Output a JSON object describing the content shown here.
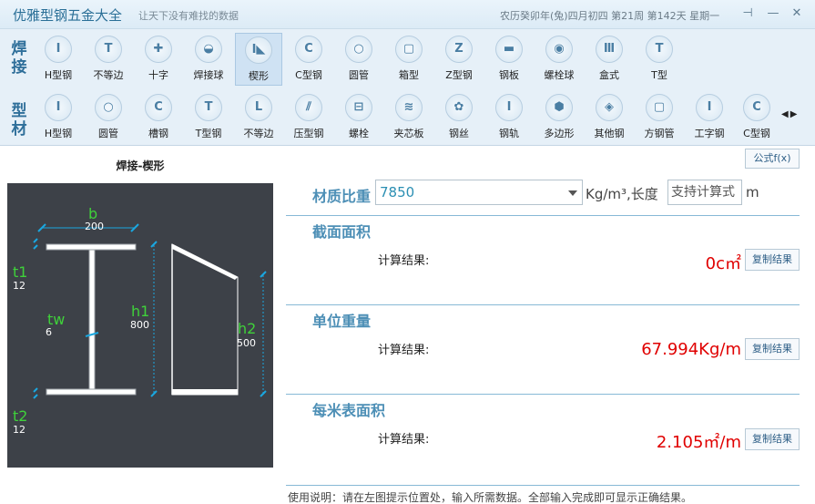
{
  "window": {
    "title": "优雅型钢五金大全",
    "subtitle": "让天下没有难找的数据",
    "date_text": "农历癸卯年(兔)四月初四 第21周 第142天 星期一",
    "buttons": {
      "pin": "⊣",
      "minimize": "—",
      "close": "✕"
    }
  },
  "toolbar": {
    "weld_group_label": "焊接",
    "profile_group_label": "型材",
    "weld_items": [
      {
        "label": "H型钢",
        "icon": "I"
      },
      {
        "label": "不等边",
        "icon": "T"
      },
      {
        "label": "十字",
        "icon": "✚"
      },
      {
        "label": "焊接球",
        "icon": "◒"
      },
      {
        "label": "楔形",
        "icon": "I◣"
      },
      {
        "label": "C型钢",
        "icon": "C"
      },
      {
        "label": "圆管",
        "icon": "○"
      },
      {
        "label": "箱型",
        "icon": "▢"
      },
      {
        "label": "Z型钢",
        "icon": "Z"
      },
      {
        "label": "钢板",
        "icon": "▬"
      },
      {
        "label": "螺栓球",
        "icon": "◉"
      },
      {
        "label": "盒式",
        "icon": "Ⅲ"
      },
      {
        "label": "T型",
        "icon": "T"
      }
    ],
    "profile_items": [
      {
        "label": "H型钢",
        "icon": "I"
      },
      {
        "label": "圆管",
        "icon": "○"
      },
      {
        "label": "槽钢",
        "icon": "C"
      },
      {
        "label": "T型钢",
        "icon": "T"
      },
      {
        "label": "不等边",
        "icon": "L"
      },
      {
        "label": "压型钢",
        "icon": "⫽"
      },
      {
        "label": "螺栓",
        "icon": "⊟"
      },
      {
        "label": "夹芯板",
        "icon": "≋"
      },
      {
        "label": "钢丝",
        "icon": "✿"
      },
      {
        "label": "钢轨",
        "icon": "I"
      },
      {
        "label": "多边形",
        "icon": "⬢"
      },
      {
        "label": "其他钢",
        "icon": "◈"
      },
      {
        "label": "方钢管",
        "icon": "▢"
      },
      {
        "label": "工字钢",
        "icon": "I"
      },
      {
        "label": "C型钢",
        "icon": "C"
      }
    ],
    "scroll_arrows": "◀▶"
  },
  "diagram": {
    "title": "焊接-楔形",
    "b_label": "b",
    "b_value": "200",
    "t1_label": "t1",
    "t1_value": "12",
    "tw_label": "tw",
    "tw_value": "6",
    "h1_label": "h1",
    "h1_value": "800",
    "h2_label": "h2",
    "h2_value": "500",
    "t2_label": "t2",
    "t2_value": "12"
  },
  "formula_button": "公式f(x)",
  "density": {
    "label": "材质比重",
    "value": "7850",
    "unit": "Kg/m³,长度",
    "length_placeholder": "支持计算式",
    "length_unit": "m"
  },
  "sections": {
    "area": {
      "title": "截面面积",
      "calc_label": "计算结果:",
      "result": "0c㎡",
      "copy": "复制结果"
    },
    "weight": {
      "title": "单位重量",
      "calc_label": "计算结果:",
      "result": "67.994Kg/m",
      "copy": "复制结果"
    },
    "surface": {
      "title": "每米表面积",
      "calc_label": "计算结果:",
      "result": "2.105㎡/m",
      "copy": "复制结果"
    }
  },
  "footer": "使用说明：请在左图提示位置处，输入所需数据。全部输入完成即可显示正确结果。",
  "colors": {
    "accent": "#4d8fb6",
    "result": "#e00000",
    "diagram_bg": "#3d4148",
    "label_green": "#3fd13a",
    "dim_cyan": "#1aa7e0"
  }
}
